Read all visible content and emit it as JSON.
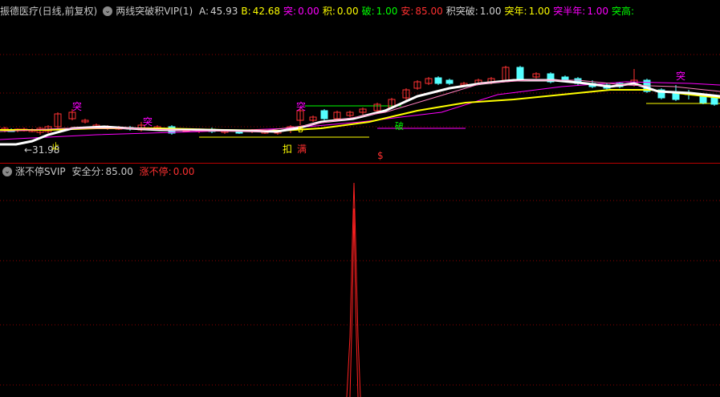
{
  "top_bar": {
    "stock_title": "振德医疗(日线,前复权)",
    "indicator_name": "两线突破积VIP(1)",
    "values": [
      {
        "label": "A:",
        "value": "45.93",
        "color": "#d0d0d0"
      },
      {
        "label": "B:",
        "value": "42.68",
        "color": "#ffff00"
      },
      {
        "label": "突:",
        "value": "0.00",
        "color": "#ff00ff"
      },
      {
        "label": "积:",
        "value": "0.00",
        "color": "#ffff00"
      },
      {
        "label": "破:",
        "value": "1.00",
        "color": "#00ff00"
      },
      {
        "label": "安:",
        "value": "85.00",
        "color": "#ff3030"
      },
      {
        "label": "积突破:",
        "value": "1.00",
        "color": "#d0d0d0"
      },
      {
        "label": "突年:",
        "value": "1.00",
        "color": "#ffff00"
      },
      {
        "label": "突半年:",
        "value": "1.00",
        "color": "#ff00ff"
      },
      {
        "label": "突高:",
        "value": "",
        "color": "#00ff00"
      }
    ]
  },
  "bottom_bar": {
    "indicator_name": "涨不停SVIP",
    "safety_label": "安全分:",
    "safety_value": "85.00",
    "stop_label": "涨不停:",
    "stop_value": "0.00"
  },
  "chart_labels": {
    "low_price": "←31.98",
    "tu": "突",
    "zhi": "止",
    "kou": "扣",
    "man": "满",
    "po": "破",
    "dollar": "$",
    "b_marker": "B"
  },
  "colors": {
    "background": "#000000",
    "up_candle": "#ff3232",
    "down_candle": "#54ffff",
    "line_a": "#ffffff",
    "line_b": "#ffff00",
    "magenta": "#ff00ff",
    "green": "#00ff00",
    "grid": "#8b0000"
  }
}
